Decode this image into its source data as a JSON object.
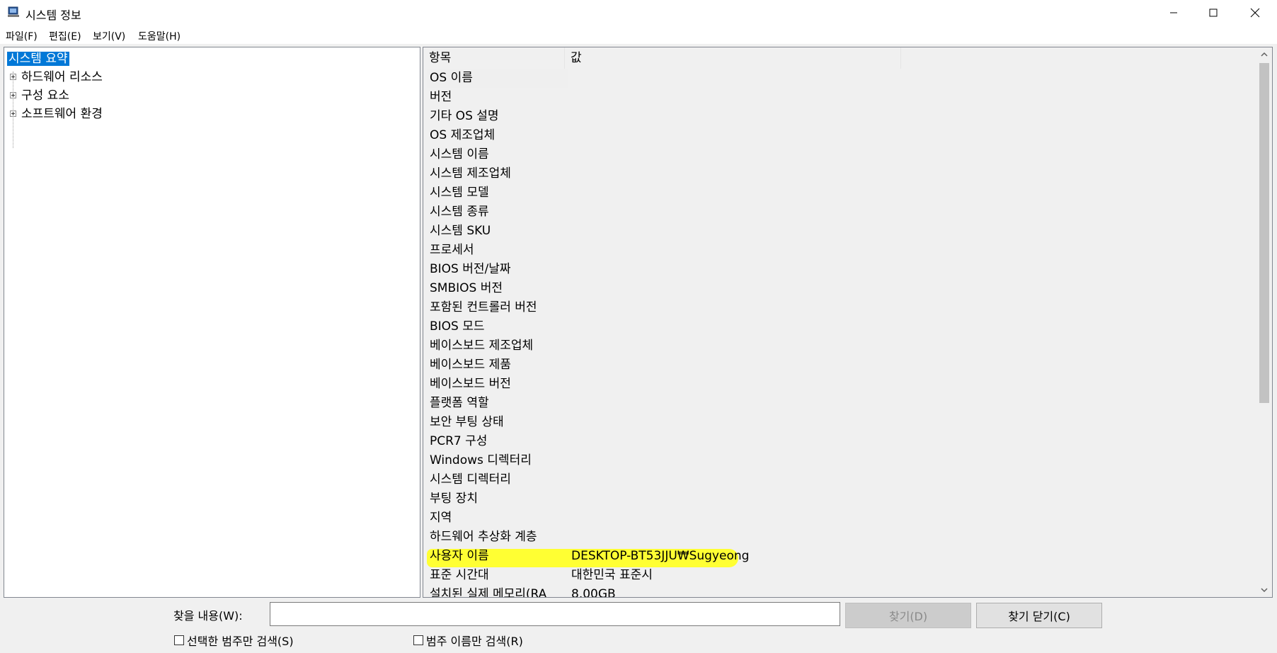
{
  "window": {
    "title": "시스템 정보"
  },
  "menu": [
    "파일(F)",
    "편집(E)",
    "보기(V)",
    "도움말(H)"
  ],
  "tree": {
    "items": [
      {
        "label": "시스템 요약",
        "selected": true
      },
      {
        "label": "하드웨어 리소스"
      },
      {
        "label": "구성 요소"
      },
      {
        "label": "소프트웨어 환경"
      }
    ]
  },
  "list": {
    "headers": {
      "item": "항목",
      "value": "값"
    },
    "rows": [
      {
        "key": "OS 이름",
        "value": ""
      },
      {
        "key": "버전",
        "value": ""
      },
      {
        "key": "기타 OS 설명",
        "value": ""
      },
      {
        "key": "OS 제조업체",
        "value": ""
      },
      {
        "key": "시스템 이름",
        "value": ""
      },
      {
        "key": "시스템 제조업체",
        "value": ""
      },
      {
        "key": "시스템 모델",
        "value": ""
      },
      {
        "key": "시스템 종류",
        "value": ""
      },
      {
        "key": "시스템 SKU",
        "value": ""
      },
      {
        "key": "프로세서",
        "value": ""
      },
      {
        "key": "BIOS 버전/날짜",
        "value": ""
      },
      {
        "key": "SMBIOS 버전",
        "value": ""
      },
      {
        "key": "포함된 컨트롤러 버전",
        "value": ""
      },
      {
        "key": "BIOS 모드",
        "value": ""
      },
      {
        "key": "베이스보드 제조업체",
        "value": ""
      },
      {
        "key": "베이스보드 제품",
        "value": ""
      },
      {
        "key": "베이스보드 버전",
        "value": ""
      },
      {
        "key": "플랫폼 역할",
        "value": ""
      },
      {
        "key": "보안 부팅 상태",
        "value": ""
      },
      {
        "key": "PCR7 구성",
        "value": ""
      },
      {
        "key": "Windows 디렉터리",
        "value": ""
      },
      {
        "key": "시스템 디렉터리",
        "value": ""
      },
      {
        "key": "부팅 장치",
        "value": ""
      },
      {
        "key": "지역",
        "value": ""
      },
      {
        "key": "하드웨어 추상화 계층",
        "value": ""
      },
      {
        "key": "사용자 이름",
        "value": "DESKTOP-BT53JJU₩Sugyeong"
      },
      {
        "key": "표준 시간대",
        "value": "대한민국 표준시"
      },
      {
        "key": "설치된 실제 메모리(RA",
        "value": "8.00GB"
      }
    ]
  },
  "find": {
    "label": "찾을 내용(W):",
    "value": "",
    "find_button": "찾기(D)",
    "close_button": "찾기 닫기(C)",
    "checkbox_selected_category": "선택한 범주만 검색(S)",
    "checkbox_category_names": "범주 이름만 검색(R)"
  },
  "colors": {
    "selection": "#0078d7",
    "highlight": "#ffff33"
  }
}
